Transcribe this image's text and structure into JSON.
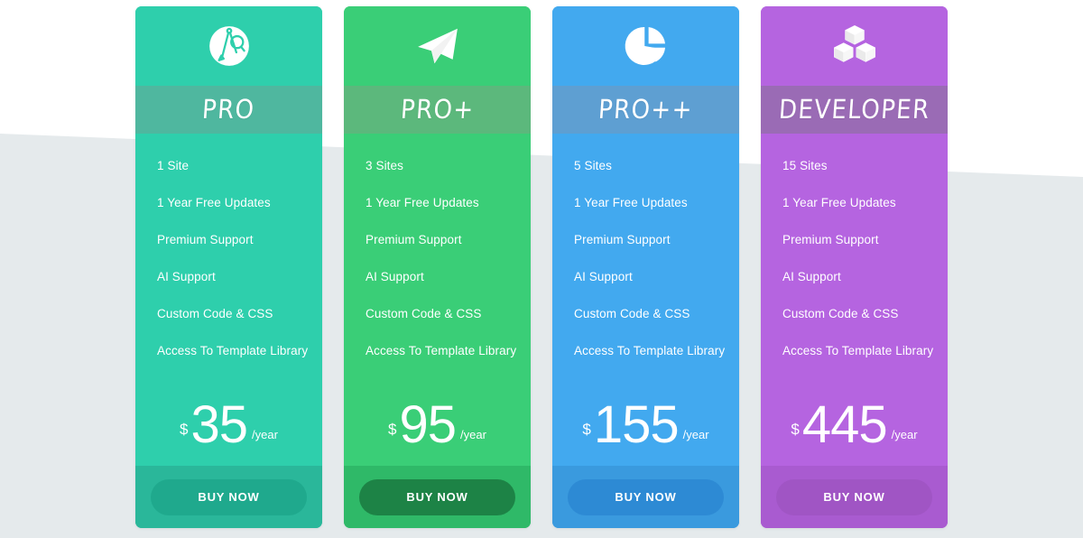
{
  "page": {
    "background_color": "#ffffff",
    "band_color": "#e5eaec"
  },
  "plans": [
    {
      "id": "pro",
      "name": "PRO",
      "icon": "compass-divider-icon",
      "body_color": "#2ecfac",
      "header_color": "#2ecfac",
      "title_band_color": "#4fb79f",
      "footer_color": "#2ab79a",
      "button_color": "#1fa98d",
      "features": [
        "1 Site",
        "1 Year Free Updates",
        "Premium Support",
        "AI Support",
        "Custom Code & CSS",
        "Access To Template Library"
      ],
      "currency": "$",
      "price": "35",
      "period": "/year",
      "button_label": "BUY NOW"
    },
    {
      "id": "pro-plus",
      "name": "PRO+",
      "icon": "paper-plane-icon",
      "body_color": "#3ace77",
      "header_color": "#3ace77",
      "title_band_color": "#5cb87c",
      "footer_color": "#2fb968",
      "button_color": "#1d8346",
      "features": [
        "3 Sites",
        "1 Year Free Updates",
        "Premium Support",
        "AI Support",
        "Custom Code & CSS",
        "Access To Template Library"
      ],
      "currency": "$",
      "price": "95",
      "period": "/year",
      "button_label": "BUY NOW"
    },
    {
      "id": "pro-plus-plus",
      "name": "PRO++",
      "icon": "pie-chart-icon",
      "body_color": "#42a9ef",
      "header_color": "#42a9ef",
      "title_band_color": "#5e9fd2",
      "footer_color": "#3a9ade",
      "button_color": "#2d8ad4",
      "features": [
        "5 Sites",
        "1 Year Free Updates",
        "Premium Support",
        "AI Support",
        "Custom Code & CSS",
        "Access To Template Library"
      ],
      "currency": "$",
      "price": "155",
      "period": "/year",
      "button_label": "BUY NOW"
    },
    {
      "id": "developer",
      "name": "DEVELOPER",
      "icon": "cubes-icon",
      "body_color": "#b564e0",
      "header_color": "#b564e0",
      "title_band_color": "#9a6bb5",
      "footer_color": "#a95bd0",
      "button_color": "#a055c4",
      "features": [
        "15 Sites",
        "1 Year Free Updates",
        "Premium Support",
        "AI Support",
        "Custom Code & CSS",
        "Access To Template Library"
      ],
      "currency": "$",
      "price": "445",
      "period": "/year",
      "button_label": "BUY NOW"
    }
  ]
}
